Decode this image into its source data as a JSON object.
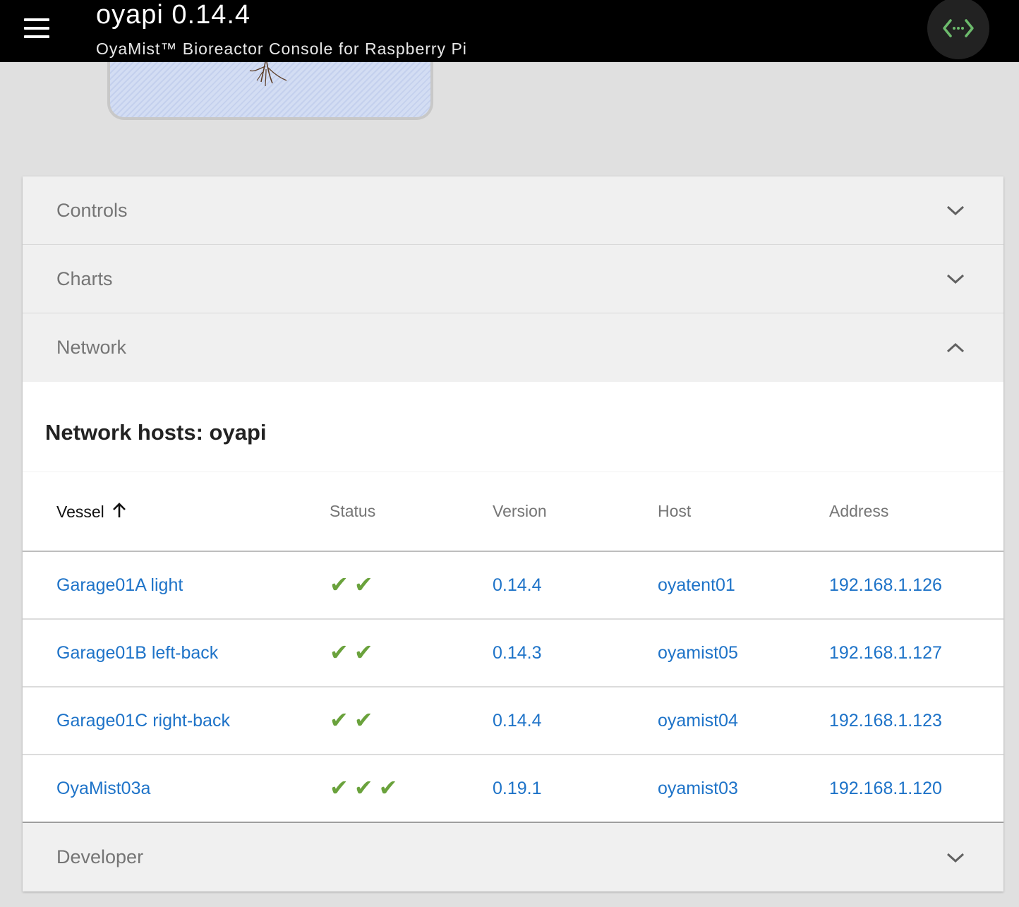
{
  "appbar": {
    "title": "oyapi 0.14.4",
    "subtitle": "OyaMist™ Bioreactor Console for Raspberry Pi",
    "menu_icon": "hamburger-menu-icon",
    "status_icon": "code-arrows-icon",
    "status_icon_color": "#6cbb6c"
  },
  "panels": {
    "controls": {
      "label": "Controls"
    },
    "charts": {
      "label": "Charts"
    },
    "network": {
      "label": "Network"
    },
    "developer": {
      "label": "Developer"
    }
  },
  "network": {
    "card_title": "Network hosts: oyapi",
    "columns": {
      "vessel": "Vessel",
      "status": "Status",
      "version": "Version",
      "host": "Host",
      "address": "Address"
    },
    "sort": {
      "column": "Vessel",
      "direction": "ascending"
    },
    "rows": [
      {
        "vessel": "Garage01A light",
        "status": "✔✔",
        "version": "0.14.4",
        "host": "oyatent01",
        "address": "192.168.1.126"
      },
      {
        "vessel": "Garage01B left-back",
        "status": "✔✔",
        "version": "0.14.3",
        "host": "oyamist05",
        "address": "192.168.1.127"
      },
      {
        "vessel": "Garage01C right-back",
        "status": "✔✔",
        "version": "0.14.4",
        "host": "oyamist04",
        "address": "192.168.1.123"
      },
      {
        "vessel": "OyaMist03a",
        "status": "✔✔✔",
        "version": "0.19.1",
        "host": "oyamist03",
        "address": "192.168.1.120"
      }
    ]
  },
  "colors": {
    "appbar_bg": "#000000",
    "link": "#1e73c8",
    "check": "#6aa23c",
    "panel_bg": "#f0f0f0",
    "page_bg": "#e0e0e0"
  }
}
